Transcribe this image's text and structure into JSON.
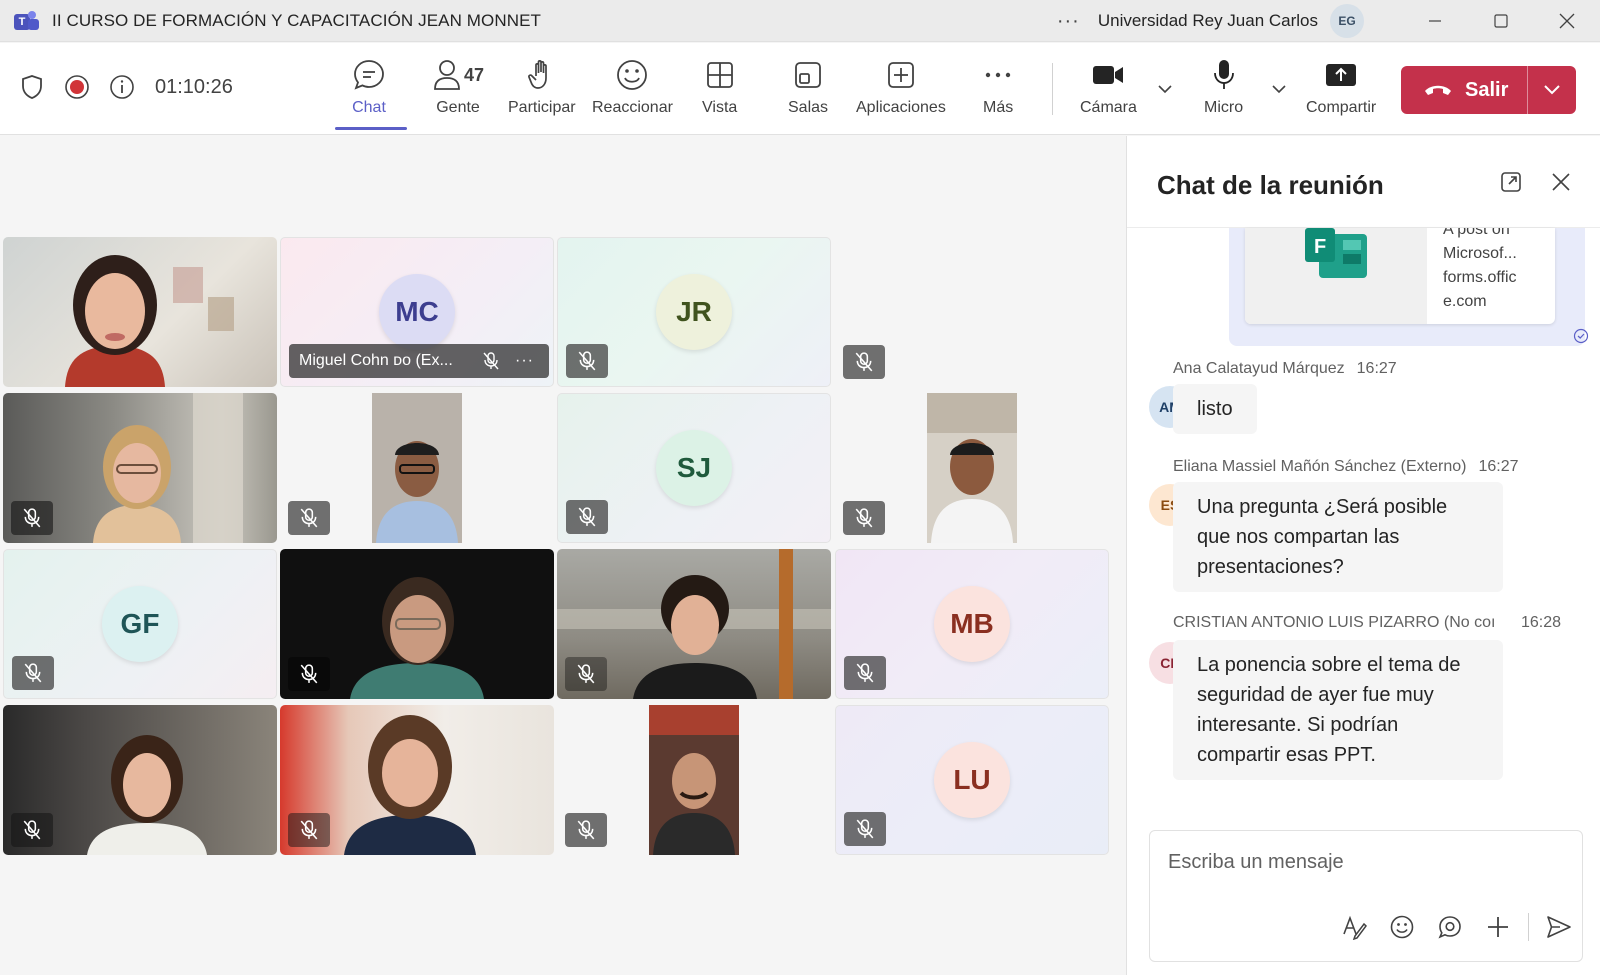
{
  "window": {
    "title": "II CURSO DE FORMACIÓN Y CAPACITACIÓN JEAN MONNET",
    "more": "···",
    "org": "Universidad Rey Juan Carlos",
    "user_initials": "EG"
  },
  "toolbar": {
    "timer": "01:10:26",
    "items": {
      "chat": "Chat",
      "people": "Gente",
      "people_count": "47",
      "raise": "Participar",
      "react": "Reaccionar",
      "view": "Vista",
      "rooms": "Salas",
      "apps": "Aplicaciones",
      "more": "Más",
      "camera": "Cámara",
      "mic": "Micro",
      "share": "Compartir"
    },
    "leave_label": "Salir",
    "accent": "#5b5fc7",
    "leave_color": "#c4314b"
  },
  "participants": {
    "mc_initials": "MC",
    "mc_name": "Miguel Cohn ᴅᴏ (Ex...",
    "jr_initials": "JR",
    "sj_initials": "SJ",
    "gf_initials": "GF",
    "mb_initials": "MB",
    "lu_initials": "LU"
  },
  "chat": {
    "title": "Chat de la reunión",
    "card": {
      "line1": "A post on",
      "line2": "Microsof...",
      "line3": "forms.offic",
      "line4": "e.com"
    },
    "messages": [
      {
        "author": "Ana Calatayud Márquez",
        "time": "16:27",
        "initials": "AM",
        "text": "listo"
      },
      {
        "author": "Eliana Massiel Mañón Sánchez (Externo)",
        "time": "16:27",
        "initials": "ES",
        "text": "Una pregunta ¿Será posible que nos compartan las presentaciones?"
      },
      {
        "author": "CRISTIAN ANTONIO LUIS PIZARRO (No coı",
        "time": "16:28",
        "initials": "CP",
        "text": "La ponencia sobre el tema de seguridad de ayer fue muy interesante. Si podrían compartir esas PPT."
      }
    ],
    "compose_placeholder": "Escriba un mensaje"
  }
}
